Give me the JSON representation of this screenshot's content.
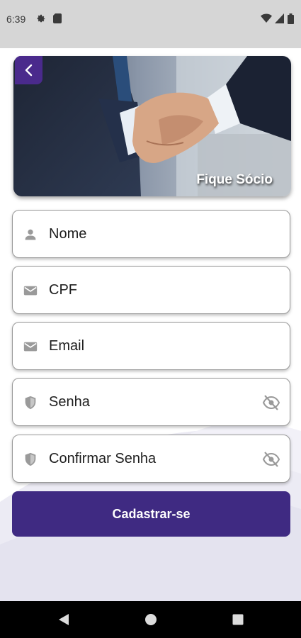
{
  "status_bar": {
    "time": "6:39"
  },
  "hero": {
    "title": "Fique Sócio"
  },
  "form": {
    "fields": [
      {
        "label": "Nome",
        "icon": "person-icon"
      },
      {
        "label": "CPF",
        "icon": "envelope-icon"
      },
      {
        "label": "Email",
        "icon": "envelope-icon"
      },
      {
        "label": "Senha",
        "icon": "shield-icon",
        "toggle_icon": "eye-off-icon"
      },
      {
        "label": "Confirmar Senha",
        "icon": "shield-icon",
        "toggle_icon": "eye-off-icon"
      }
    ],
    "submit_label": "Cadastrar-se"
  },
  "colors": {
    "accent": "#3f2a82",
    "back_button": "#4a2a8c",
    "status_bar_bg": "#d6d6d6",
    "nav_bar_bg": "#000000"
  }
}
